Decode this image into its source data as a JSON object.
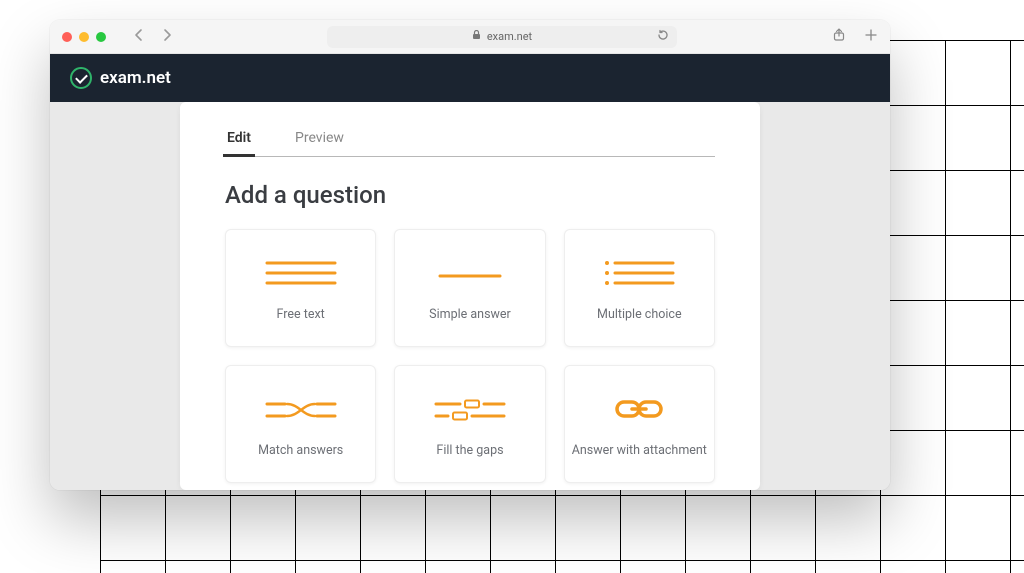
{
  "browser": {
    "url_host": "exam.net"
  },
  "brand": {
    "name": "exam.net"
  },
  "tabs": {
    "edit": "Edit",
    "preview": "Preview"
  },
  "heading": "Add a question",
  "questions": {
    "free_text": "Free text",
    "simple_answer": "Simple answer",
    "multiple_choice": "Multiple choice",
    "match_answers": "Match answers",
    "fill_gaps": "Fill the gaps",
    "answer_attachment": "Answer with attachment"
  },
  "colors": {
    "accent": "#f39a1f",
    "header": "#1b2430",
    "brand_ring": "#2fb46a"
  }
}
